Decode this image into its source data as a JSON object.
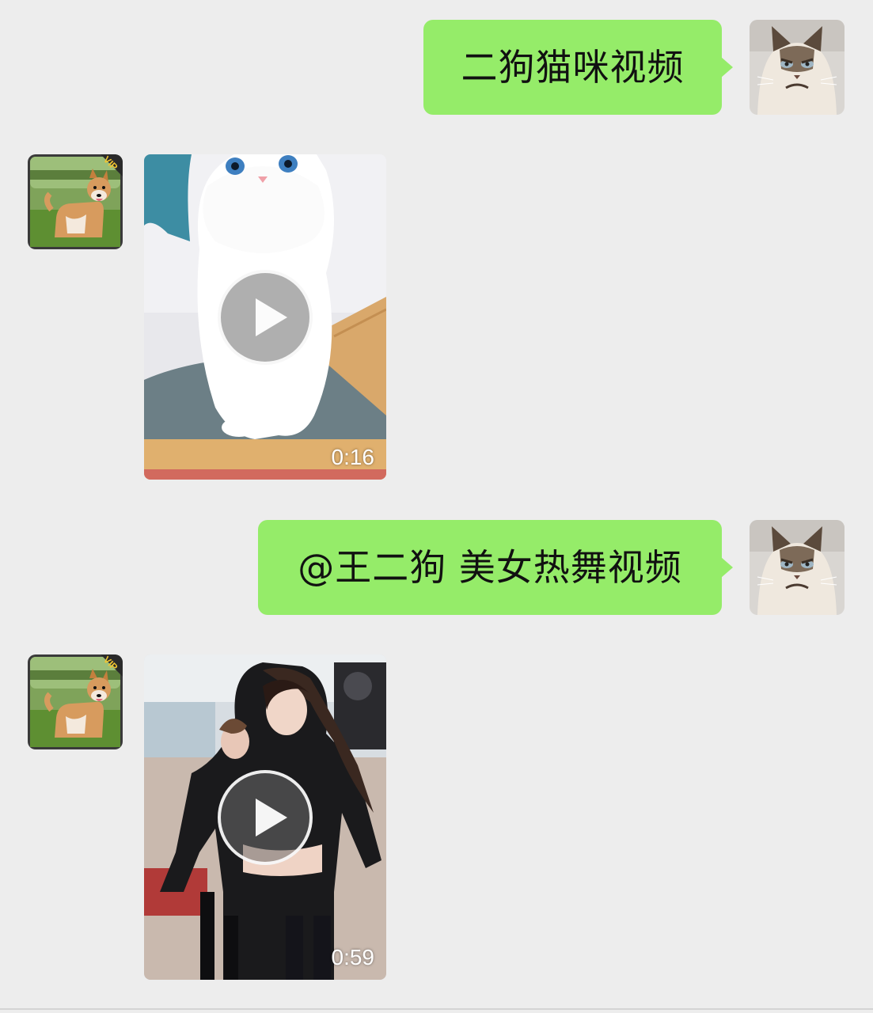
{
  "chat": {
    "messages": [
      {
        "sender": "self",
        "type": "text",
        "text": "二狗猫咪视频",
        "avatar_icon": "grumpy-cat-avatar-icon"
      },
      {
        "sender": "other",
        "type": "video",
        "duration": "0:16",
        "avatar_icon": "shiba-dog-vip-avatar-icon",
        "thumbnail": "white-kitten"
      },
      {
        "sender": "self",
        "type": "text",
        "text": "@王二狗 美女热舞视频",
        "avatar_icon": "grumpy-cat-avatar-icon"
      },
      {
        "sender": "other",
        "type": "video",
        "duration": "0:59",
        "avatar_icon": "shiba-dog-vip-avatar-icon",
        "thumbnail": "dancer"
      }
    ],
    "badge": "VIP"
  },
  "colors": {
    "background": "#ededed",
    "bubble_self": "#95ec69",
    "text": "#111111"
  }
}
